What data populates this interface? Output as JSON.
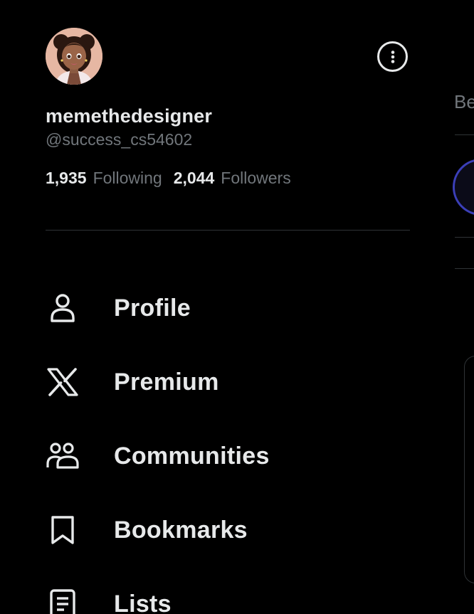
{
  "profile": {
    "display_name": "memethedesigner",
    "handle": "@success_cs54602",
    "avatar_icon": "cartoon-avatar"
  },
  "stats": {
    "following_count": "1,935",
    "following_label": "Following",
    "followers_count": "2,044",
    "followers_label": "Followers"
  },
  "more_icon": "more-options-icon",
  "menu": {
    "items": [
      {
        "label": "Profile",
        "icon": "person-icon"
      },
      {
        "label": "Premium",
        "icon": "x-logo-icon"
      },
      {
        "label": "Communities",
        "icon": "communities-icon"
      },
      {
        "label": "Bookmarks",
        "icon": "bookmark-icon"
      },
      {
        "label": "Lists",
        "icon": "list-icon"
      }
    ]
  },
  "background": {
    "tab_fragment": "Be"
  },
  "colors": {
    "background": "#000000",
    "primary_text": "#e7e9ea",
    "secondary_text": "#71767b",
    "divider": "#2f3336"
  }
}
